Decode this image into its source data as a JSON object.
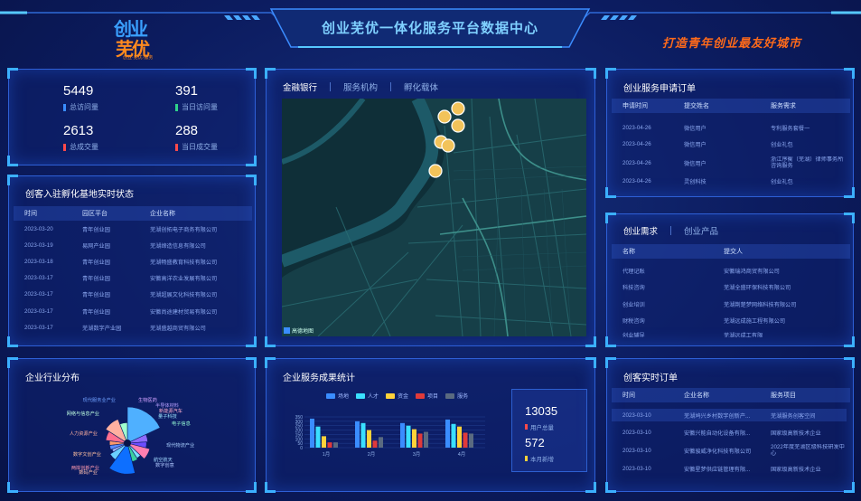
{
  "header": {
    "title": "创业芜优一体化服务平台数据中心",
    "slogan": "打造青年创业最友好城市",
    "logo_line1": "创业",
    "logo_line2": "芜优",
    "logo_sub": "创业·芜优·服务"
  },
  "stats": [
    {
      "value": "5449",
      "label": "总访问量",
      "color": "#3a8dff"
    },
    {
      "value": "391",
      "label": "当日访问量",
      "color": "#2fd28a"
    },
    {
      "value": "2613",
      "label": "总成交量",
      "color": "#ff4a4a"
    },
    {
      "value": "288",
      "label": "当日成交量",
      "color": "#ff4a4a"
    }
  ],
  "incubator": {
    "title": "创客入驻孵化基地实时状态",
    "headers": [
      "时间",
      "园区平台",
      "企业名称"
    ],
    "rows": [
      [
        "2023-03-20",
        "青年创业园",
        "芜湖创拓电子商务有限公司"
      ],
      [
        "2023-03-19",
        "易网产业园",
        "芜湖缔造信息有限公司"
      ],
      [
        "2023-03-18",
        "青年创业园",
        "芜湖畅盛教育科技有限公司"
      ],
      [
        "2023-03-17",
        "青年创业园",
        "安徽高洋农业发展有限公司"
      ],
      [
        "2023-03-17",
        "青年创业园",
        "芜湖超展文化科技有限公司"
      ],
      [
        "2023-03-17",
        "青年创业园",
        "安徽尚途建材贸易有限公司"
      ],
      [
        "2023-03-17",
        "芜湖数字产业园",
        "芜湖盛越商贸有限公司"
      ]
    ]
  },
  "map_tabs": [
    "金融银行",
    "服务机构",
    "孵化载体"
  ],
  "map_logo": "高德地图",
  "apply": {
    "title": "创业服务申请订单",
    "headers": [
      "申请时间",
      "提交姓名",
      "服务需求"
    ],
    "rows": [
      [
        "2023-04-26",
        "微信用户",
        "专利服务套餐一"
      ],
      [
        "2023-04-26",
        "微信用户",
        "创业礼包"
      ],
      [
        "2023-04-26",
        "微信用户",
        "浙江序衡（芜湖）律师事务所咨询服务"
      ],
      [
        "2023-04-26",
        "灵创科技",
        "创业礼包"
      ]
    ]
  },
  "demand": {
    "tabs": [
      "创业需求",
      "创业产品"
    ],
    "headers": [
      "名称",
      "提交人"
    ],
    "rows": [
      [
        "代理记账",
        "安徽瑞鸿商贸有限公司"
      ],
      [
        "科技咨询",
        "芜湖全盛环保科技有限公司"
      ],
      [
        "创业培训",
        "芜湖荆楚梦网络科技有限公司"
      ],
      [
        "财税咨询",
        "芜湖远成施工程有限公司"
      ],
      [
        "创业辅导",
        "芜湖远成工有限"
      ]
    ]
  },
  "industry": {
    "title": "企业行业分布",
    "labels": [
      "现代服务业产业",
      "生物医药",
      "半导体材料",
      "新能源汽车",
      "量子科技",
      "电子信息",
      "现代物流产业",
      "航空航天",
      "数字创意",
      "网络与信息产业",
      "人力资源产业",
      "数字文创产业",
      "两岸创新产业",
      "数码产业"
    ]
  },
  "service": {
    "title": "企业服务成果统计",
    "kpi_total": "13035",
    "kpi_total_label": "用户总量",
    "kpi_month": "572",
    "kpi_month_label": "本月新增"
  },
  "orders": {
    "title": "创客实时订单",
    "headers": [
      "时间",
      "企业名称",
      "服务项目"
    ],
    "rows": [
      [
        "2023-03-10",
        "芜湖鸠兴乡村数字创新产...",
        "芜湖服务创客空间"
      ],
      [
        "2023-03-10",
        "安徽兴能自动化设备有限...",
        "国家级高新技术企业"
      ],
      [
        "2023-03-10",
        "安徽骏威净化科技有限公司",
        "2022年度芜湖区级科技研发中心"
      ],
      [
        "2023-03-10",
        "安徽星梦供应链管理有限...",
        "国家级高新技术企业"
      ]
    ]
  },
  "chart_data": {
    "type": "bar",
    "categories": [
      "1月",
      "2月",
      "3月",
      "4月"
    ],
    "series": [
      {
        "name": "场地",
        "color": "#3a8dff",
        "values": [
          330,
          300,
          280,
          320
        ]
      },
      {
        "name": "人才",
        "color": "#3ae0ff",
        "values": [
          240,
          280,
          250,
          270
        ]
      },
      {
        "name": "资金",
        "color": "#ffd23a",
        "values": [
          130,
          200,
          210,
          240
        ]
      },
      {
        "name": "项目",
        "color": "#e03a3a",
        "values": [
          60,
          80,
          160,
          170
        ]
      },
      {
        "name": "服务",
        "color": "#5a6a80",
        "values": [
          60,
          120,
          180,
          160
        ]
      }
    ],
    "ylim": [
      0,
      350
    ],
    "yticks": [
      "350",
      "300",
      "250",
      "200",
      "150",
      "100",
      "50",
      "0"
    ]
  },
  "pie_data": {
    "type": "pie",
    "values": [
      18,
      6,
      5,
      8,
      4,
      5,
      14,
      6,
      3,
      4,
      4,
      7,
      10,
      6
    ],
    "colors": [
      "#4fb0ff",
      "#8e6cff",
      "#6c4dff",
      "#ff7eb0",
      "#7adfff",
      "#3ad0a0",
      "#0d6fff",
      "#6ad0ff",
      "#9ab7ff",
      "#5a8cff",
      "#ff9a6a",
      "#ff6f8f",
      "#ffb0a0",
      "#a0ffd0"
    ]
  }
}
